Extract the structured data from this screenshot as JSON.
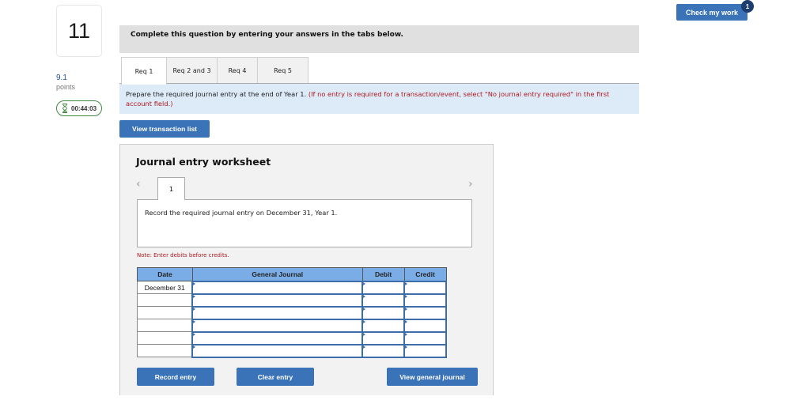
{
  "question": {
    "number": "11",
    "points_value": "9.1",
    "points_label": "points",
    "timer": "00:44:03"
  },
  "header": {
    "check_my_work": "Check my work",
    "check_badge": "1"
  },
  "instructions": "Complete this question by entering your answers in the tabs below.",
  "tabs": [
    {
      "label": "Req 1",
      "active": true
    },
    {
      "label": "Req 2 and 3",
      "active": false
    },
    {
      "label": "Req 4",
      "active": false
    },
    {
      "label": "Req 5",
      "active": false
    }
  ],
  "prompt": {
    "text": "Prepare the required journal entry at the end of Year 1.",
    "note": "(If no entry is required for a transaction/event, select \"No journal entry required\" in the first account field.)"
  },
  "view_transaction_list": "View transaction list",
  "worksheet": {
    "title": "Journal entry worksheet",
    "prev_icon": "chevron-left",
    "next_icon": "chevron-right",
    "entry_tab": "1",
    "entry_description": "Record the required journal entry on December 31, Year 1.",
    "note": "Note: Enter debits before credits.",
    "table": {
      "headers": [
        "Date",
        "General Journal",
        "Debit",
        "Credit"
      ],
      "rows": [
        {
          "date": "December 31",
          "account": "",
          "debit": "",
          "credit": ""
        },
        {
          "date": "",
          "account": "",
          "debit": "",
          "credit": ""
        },
        {
          "date": "",
          "account": "",
          "debit": "",
          "credit": ""
        },
        {
          "date": "",
          "account": "",
          "debit": "",
          "credit": ""
        },
        {
          "date": "",
          "account": "",
          "debit": "",
          "credit": ""
        },
        {
          "date": "",
          "account": "",
          "debit": "",
          "credit": ""
        }
      ]
    },
    "buttons": {
      "record": "Record entry",
      "clear": "Clear entry",
      "view_journal": "View general journal"
    }
  }
}
